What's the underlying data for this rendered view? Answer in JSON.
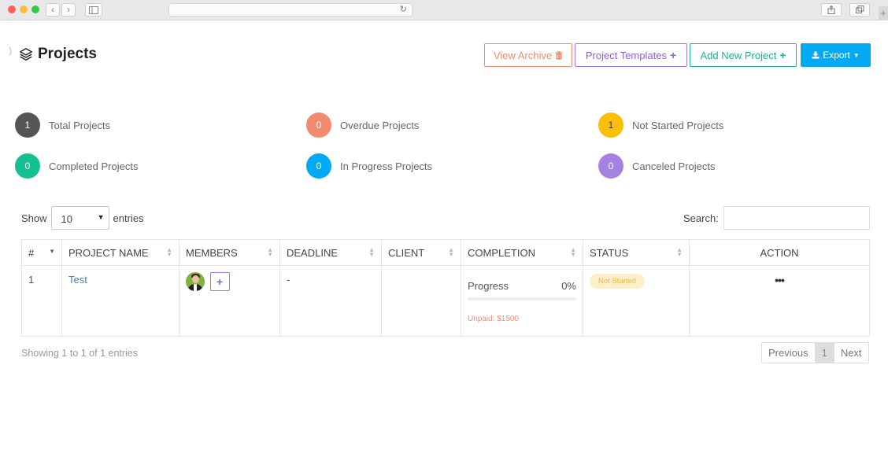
{
  "browser": {
    "back": "‹",
    "forward": "›",
    "reload": "↻",
    "new_tab": "+"
  },
  "header": {
    "title": "Projects",
    "buttons": {
      "archive": "View Archive",
      "templates": "Project Templates",
      "add_new": "Add New Project",
      "export": "Export"
    }
  },
  "stats": [
    {
      "count": "1",
      "label": "Total Projects",
      "color": "#555555"
    },
    {
      "count": "0",
      "label": "Overdue Projects",
      "color": "#f28b6e"
    },
    {
      "count": "1",
      "label": "Not Started Projects",
      "color": "#fbbf0a"
    },
    {
      "count": "0",
      "label": "Completed Projects",
      "color": "#16c090"
    },
    {
      "count": "0",
      "label": "In Progress Projects",
      "color": "#03a9f4"
    },
    {
      "count": "0",
      "label": "Canceled Projects",
      "color": "#a382e2"
    }
  ],
  "controls": {
    "show_label": "Show",
    "page_size": "10",
    "entries_label": "entries",
    "search_label": "Search:"
  },
  "table": {
    "columns": [
      "#",
      "PROJECT NAME",
      "MEMBERS",
      "DEADLINE",
      "CLIENT",
      "COMPLETION",
      "STATUS",
      "ACTION"
    ],
    "rows": [
      {
        "index": "1",
        "name": "Test",
        "deadline": "-",
        "client": "",
        "progress_label": "Progress",
        "progress_percent": "0%",
        "progress_value": 0,
        "unpaid": "Unpaid: $1500",
        "status": "Not Started",
        "action": "•••"
      }
    ]
  },
  "footer": {
    "showing": "Showing 1 to 1 of 1 entries",
    "previous": "Previous",
    "page": "1",
    "next": "Next"
  },
  "colors": {
    "accent_blue": "#03a9f4",
    "archive": "#f28b6e",
    "templates": "#a178e0",
    "add_new": "#19b58f"
  }
}
